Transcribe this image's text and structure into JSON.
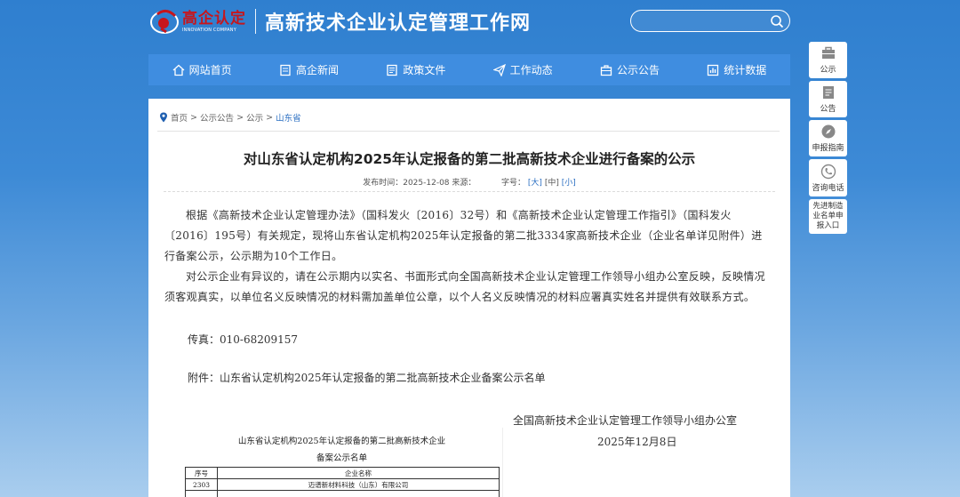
{
  "header": {
    "logo_cn": "高企认定",
    "logo_en": "INNOVATION COMPANY",
    "site_title": "高新技术企业认定管理工作网",
    "search_placeholder": ""
  },
  "nav": {
    "items": [
      {
        "label": "网站首页",
        "icon": "home-icon"
      },
      {
        "label": "高企新闻",
        "icon": "news-icon"
      },
      {
        "label": "政策文件",
        "icon": "document-icon"
      },
      {
        "label": "工作动态",
        "icon": "send-icon"
      },
      {
        "label": "公示公告",
        "icon": "briefcase-icon"
      },
      {
        "label": "统计数据",
        "icon": "chart-icon"
      }
    ]
  },
  "side_tools": [
    {
      "label": "公示",
      "icon": "briefcase-icon"
    },
    {
      "label": "公告",
      "icon": "notice-icon"
    },
    {
      "label": "申报指南",
      "icon": "compass-icon"
    },
    {
      "label": "咨询电话",
      "icon": "phone-icon"
    },
    {
      "label": "先进制造业名单申报入口",
      "icon": ""
    }
  ],
  "breadcrumb": {
    "home": "首页",
    "sep": ">",
    "level1": "公示公告",
    "level2": "公示",
    "current": "山东省"
  },
  "article": {
    "title": "对山东省认定机构2025年认定报备的第二批高新技术企业进行备案的公示",
    "meta_date": "发布时间：2025-12-08 来源：",
    "meta_fontsize_label": "字号：",
    "font_sizes": [
      "[大]",
      "[中]",
      "[小]"
    ],
    "para1": "根据《高新技术企业认定管理办法》（国科发火〔2016〕32号）和《高新技术企业认定管理工作指引》（国科发火〔2016〕195号）有关规定，现将山东省认定机构2025年认定报备的第二批3334家高新技术企业（企业名单详见附件）进行备案公示，公示期为10个工作日。",
    "para2": "对公示企业有异议的，请在公示期内以实名、书面形式向全国高新技术企业认定管理工作领导小组办公室反映，反映情况须客观真实，以单位名义反映情况的材料需加盖单位公章，以个人名义反映情况的材料应署真实姓名并提供有效联系方式。",
    "fax": "传真：010-68209157",
    "attachment": "附件：山东省认定机构2025年认定报备的第二批高新技术企业备案公示名单",
    "signature_org": "全国高新技术企业认定管理工作领导小组办公室",
    "signature_date": "2025年12月8日"
  },
  "attachment_doc": {
    "title_line1": "山东省认定机构2025年认定报备的第二批高新技术企业",
    "title_line2": "备案公示名单",
    "columns": [
      "序号",
      "企业名称"
    ],
    "rows": [
      [
        "2303",
        "迈谱新材料科技（山东）有限公司"
      ],
      [
        "",
        ""
      ]
    ]
  },
  "colors": {
    "nav_bg": "#3f8de0",
    "accent": "#2b6fc2",
    "logo_red": "#c6161d"
  }
}
